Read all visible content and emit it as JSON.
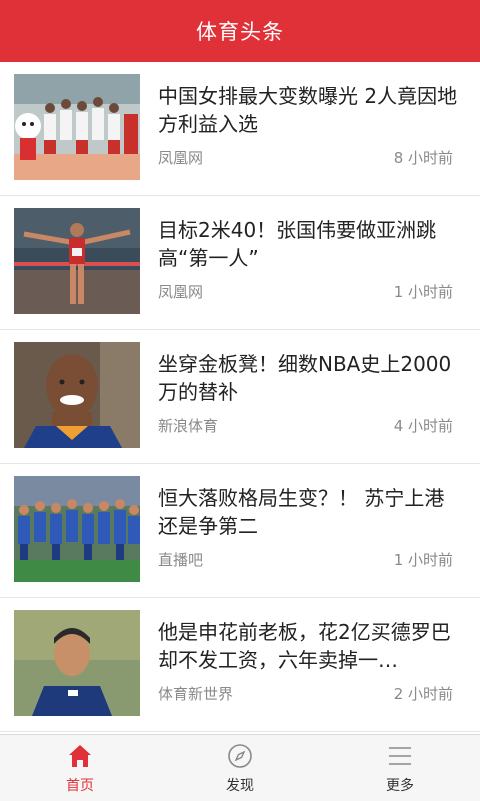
{
  "header": {
    "title": "体育头条"
  },
  "colors": {
    "brand": "#e03038",
    "text": "#222222",
    "meta": "#8a8a8a"
  },
  "news": [
    {
      "title": "中国女排最大变数曝光 2人竟因地方利益入选",
      "source": "凤凰网",
      "time": "8 小时前",
      "image": "volleyball-team-celebration"
    },
    {
      "title": "目标2米40！张国伟要做亚洲跳高“第一人”",
      "source": "凤凰网",
      "time": "1 小时前",
      "image": "high-jumper-celebrating"
    },
    {
      "title": "坐穿金板凳！细数NBA史上2000万的替补",
      "source": "新浪体育",
      "time": "4 小时前",
      "image": "basketball-player-smiling"
    },
    {
      "title": "恒大落败格局生变？！ 苏宁上港还是争第二",
      "source": "直播吧",
      "time": "1 小时前",
      "image": "soccer-team-lineup"
    },
    {
      "title": "他是申花前老板，花2亿买德罗巴却不发工资，六年卖掉一…",
      "source": "体育新世界",
      "time": "2 小时前",
      "image": "soccer-coach-portrait"
    }
  ],
  "tabbar": {
    "tabs": [
      {
        "label": "首页",
        "icon": "home-icon",
        "active": true
      },
      {
        "label": "发现",
        "icon": "compass-icon",
        "active": false
      },
      {
        "label": "更多",
        "icon": "menu-icon",
        "active": false
      }
    ]
  }
}
